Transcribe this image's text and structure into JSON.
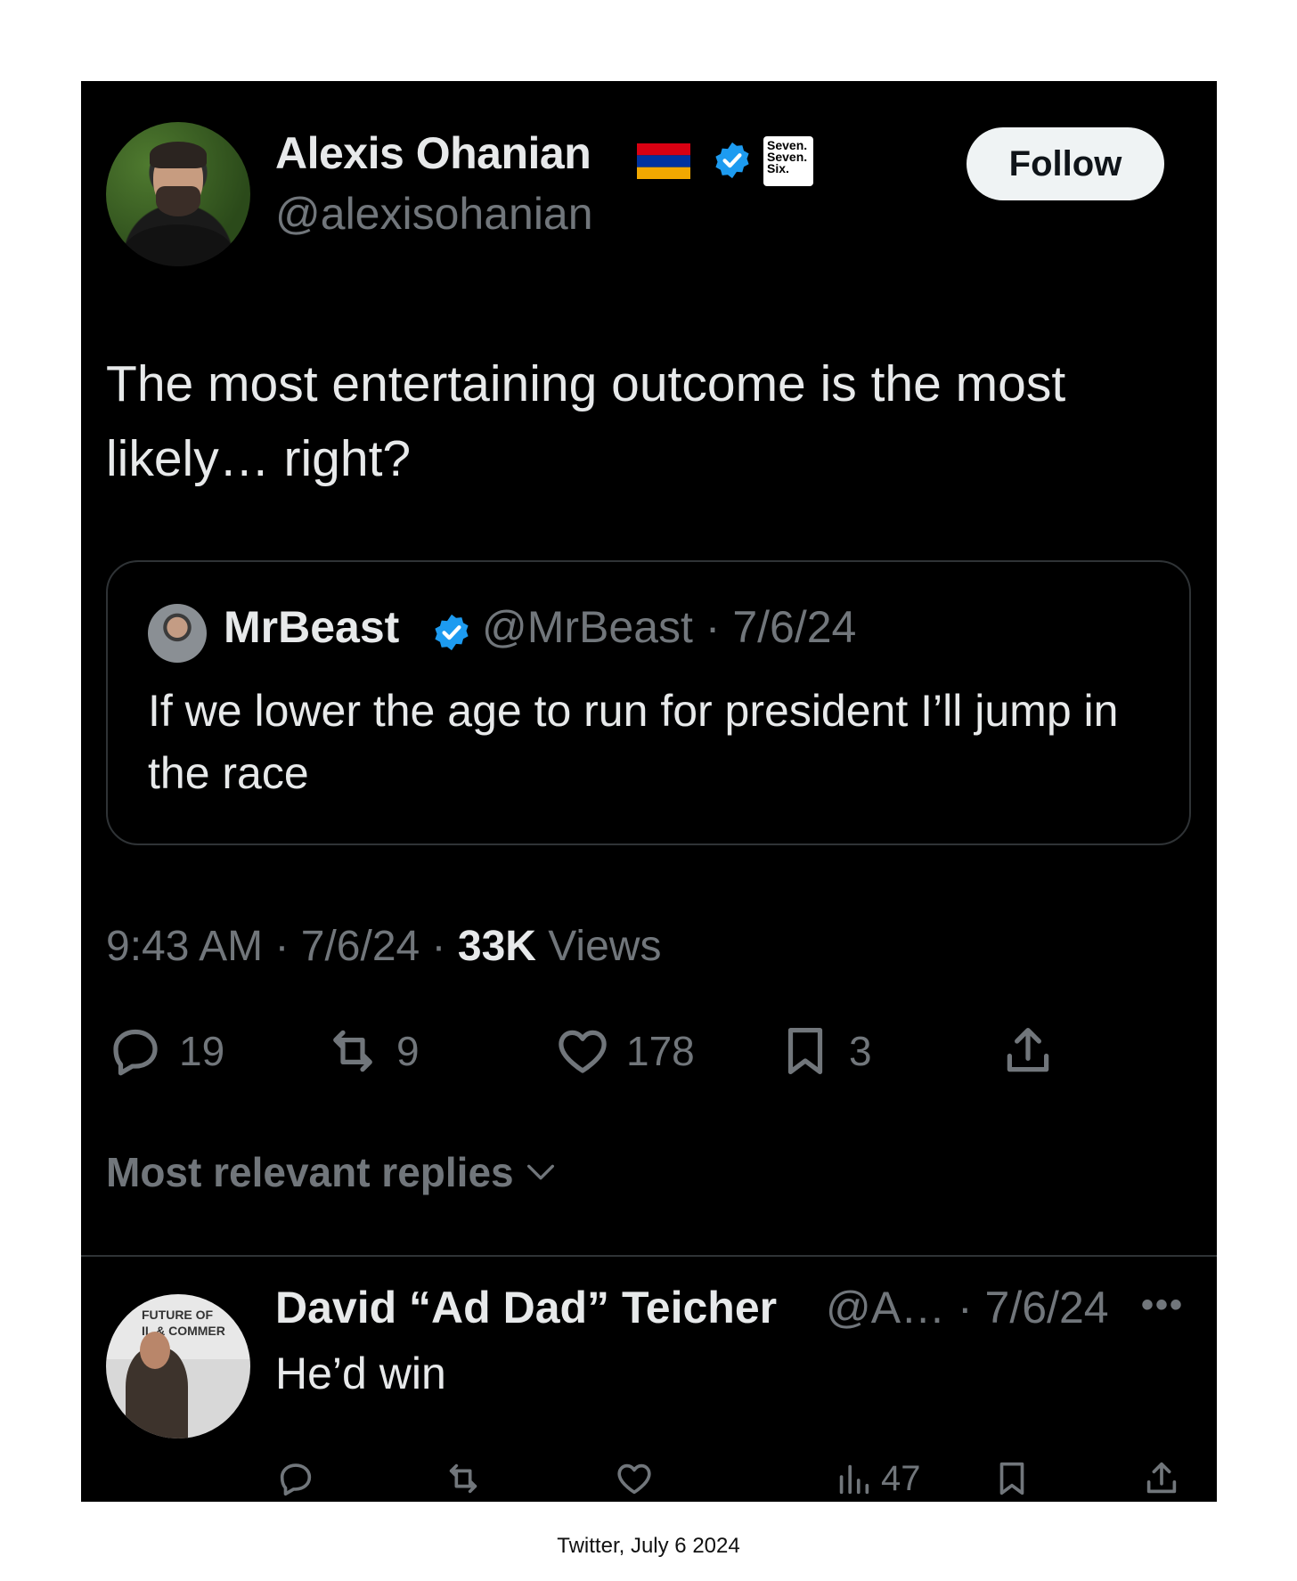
{
  "tweet": {
    "author_name": "Alexis Ohanian",
    "author_handle": "@alexisohanian",
    "affiliate_badge": "Seven. Seven. Six.",
    "follow_label": "Follow",
    "text": "The most entertaining outcome is the most likely… right?",
    "quoted": {
      "name": "MrBeast",
      "handle_date": "@MrBeast · 7/6/24",
      "text": "If we lower the age to run for president I’ll jump in the race"
    },
    "time": "9:43 AM · 7/6/24 · ",
    "views_count": "33K",
    "views_label": " Views",
    "actions": {
      "replies": "19",
      "reposts": "9",
      "likes": "178",
      "bookmarks": "3"
    },
    "replies_sort_label": "Most relevant replies"
  },
  "reply": {
    "name": "David “Ad Dad” Teicher",
    "meta": "@A… · 7/6/24",
    "more": "•••",
    "text": "He’d win",
    "views": "47"
  },
  "caption": "Twitter, July 6 2024",
  "colors": {
    "background": "#000000",
    "text_primary": "#e7e9ea",
    "text_secondary": "#71767b",
    "verified": "#1d9bf0",
    "border": "#2f3336"
  }
}
